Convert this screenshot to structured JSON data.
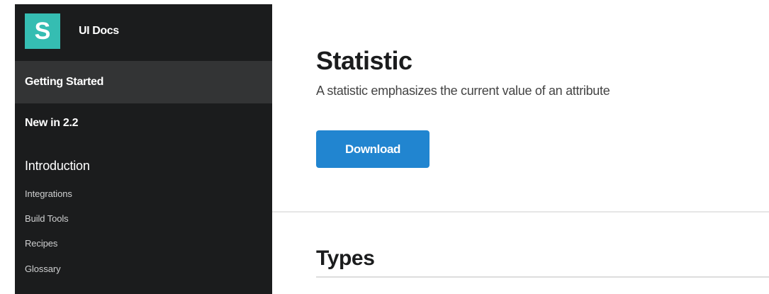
{
  "sidebar": {
    "brand": {
      "logo_letter": "S",
      "title": "UI Docs"
    },
    "items": {
      "getting_started": "Getting Started",
      "new": "New in 2.2",
      "introduction": "Introduction",
      "sub": [
        "Integrations",
        "Build Tools",
        "Recipes",
        "Glossary"
      ]
    }
  },
  "main": {
    "title": "Statistic",
    "subtitle": "A statistic emphasizes the current value of an attribute",
    "download_label": "Download",
    "section_heading": "Types"
  },
  "colors": {
    "sidebar_bg": "#1b1c1d",
    "active_item_bg": "#333435",
    "logo_bg": "#35bdb2",
    "button_blue": "#2185d0"
  }
}
